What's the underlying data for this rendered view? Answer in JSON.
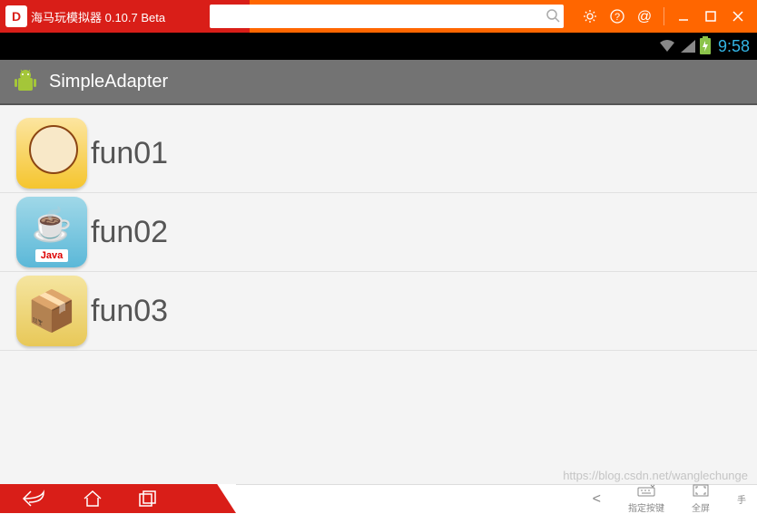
{
  "emulator": {
    "logo_text": "D",
    "title": "海马玩模拟器 0.10.7 Beta",
    "search_placeholder": "",
    "icons": {
      "settings": "gear-icon",
      "help": "help-icon",
      "at": "at-icon",
      "minimize": "minimize-icon",
      "maximize": "maximize-icon",
      "close": "close-icon"
    }
  },
  "android_status": {
    "time": "9:58"
  },
  "app": {
    "title": "SimpleAdapter"
  },
  "list": [
    {
      "text": "fun01",
      "icon": "chef"
    },
    {
      "text": "fun02",
      "icon": "java"
    },
    {
      "text": "fun03",
      "icon": "box"
    }
  ],
  "bottom_tools": {
    "back_arrow": "<",
    "keyboard_label": "指定按键",
    "fullscreen_label": "全屏",
    "phone_label": "手"
  },
  "watermark": "https://blog.csdn.net/wanglechunge"
}
